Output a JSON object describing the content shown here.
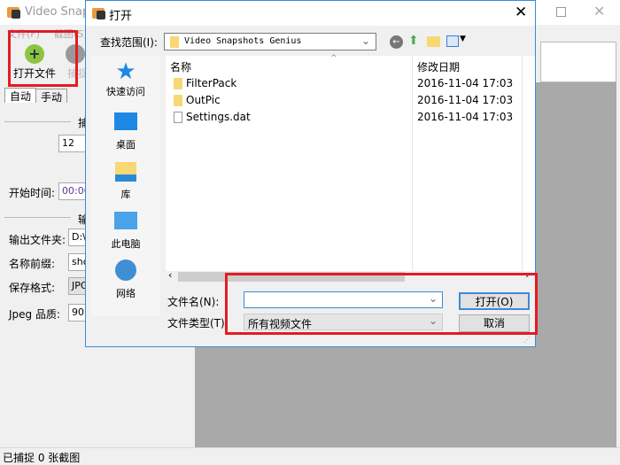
{
  "main": {
    "title": "Video Snapshots Genius",
    "menu": [
      "文件(F)",
      "截图(S)"
    ],
    "toolbar": {
      "open_file": "打开文件",
      "capture": "捕捉"
    },
    "tabs": [
      "自动",
      "手动"
    ],
    "groups": [
      "捕",
      "输"
    ],
    "interval_value": "12",
    "start_time_label": "开始时间:",
    "start_time_value": "00:00:",
    "output_folder_label": "输出文件夹:",
    "output_folder_value": "D:\\",
    "prefix_label": "名称前缀:",
    "prefix_value": "sho",
    "format_label": "保存格式:",
    "format_value": "JPG",
    "quality_label": "Jpeg 品质:",
    "quality_value": "90",
    "status": "已捕捉 0 张截图"
  },
  "dialog": {
    "title": "打开",
    "look_in_label": "查找范围(I):",
    "look_in_value": "Video Snapshots Genius",
    "places": [
      "快速访问",
      "桌面",
      "库",
      "此电脑",
      "网络"
    ],
    "columns": [
      "名称",
      "修改日期"
    ],
    "files": [
      {
        "name": "FilterPack",
        "date": "2016-11-04 17:03",
        "type": "folder"
      },
      {
        "name": "OutPic",
        "date": "2016-11-04 17:03",
        "type": "folder"
      },
      {
        "name": "Settings.dat",
        "date": "2016-11-04 17:03",
        "type": "file"
      }
    ],
    "filename_label": "文件名(N):",
    "filename_value": "",
    "filetype_label": "文件类型(T):",
    "filetype_value": "所有视频文件",
    "open_button": "打开(O)",
    "cancel_button": "取消"
  },
  "colors": {
    "highlight": "#e41b23",
    "accent": "#3c8ad8"
  }
}
